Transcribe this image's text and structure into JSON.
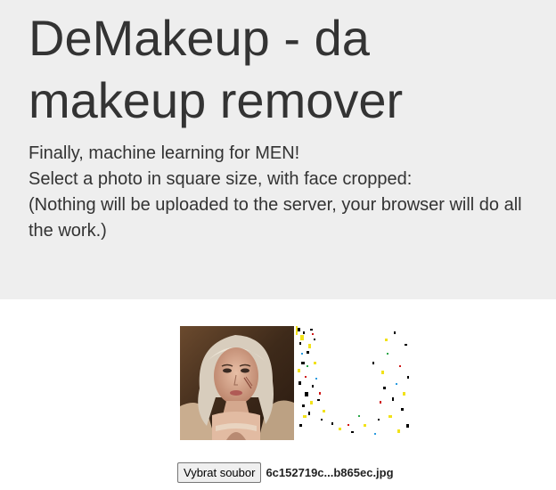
{
  "header": {
    "title": "DeMakeup - da makeup remover",
    "lines": [
      "Finally, machine learning for MEN!",
      "Select a photo in square size, with face cropped:",
      "(Nothing will be uploaded to the server, your browser will do all the work.)"
    ]
  },
  "images": {
    "input_photo_label": "",
    "output_label": ""
  },
  "file_input": {
    "button_label": "Vybrat soubor",
    "file_name": "6c152719c...b865ec.jpg"
  }
}
